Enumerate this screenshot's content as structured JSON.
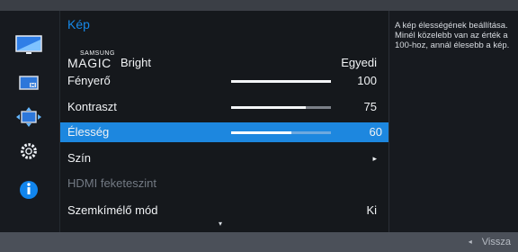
{
  "menu": {
    "title": "Kép",
    "items": [
      {
        "label": "Bright",
        "brand_top": "SAMSUNG",
        "brand_bottom": "MAGIC",
        "value": "Egyedi"
      },
      {
        "label": "Fényerő",
        "value": "100",
        "level": 100
      },
      {
        "label": "Kontraszt",
        "value": "75",
        "level": 75
      },
      {
        "label": "Élesség",
        "value": "60",
        "level": 60,
        "selected": true
      },
      {
        "label": "Szín",
        "value": "▸"
      },
      {
        "label": "HDMI feketeszint",
        "value": "",
        "disabled": true
      },
      {
        "label": "Szemkímélő mód",
        "value": "Ki"
      }
    ],
    "more_indicator": "▾"
  },
  "help": {
    "text": "A kép élességének beállítása. Minél közelebb van az érték a 100-hoz, annál élesebb a kép."
  },
  "footer": {
    "back_icon": "◂",
    "back_label": "Vissza"
  },
  "icons": [
    "picture-icon",
    "screen-size-icon",
    "position-icon",
    "settings-gear-icon",
    "information-icon"
  ],
  "colors": {
    "accent": "#1d87df",
    "text": "#f0f2f4",
    "disabled": "#737a84"
  }
}
